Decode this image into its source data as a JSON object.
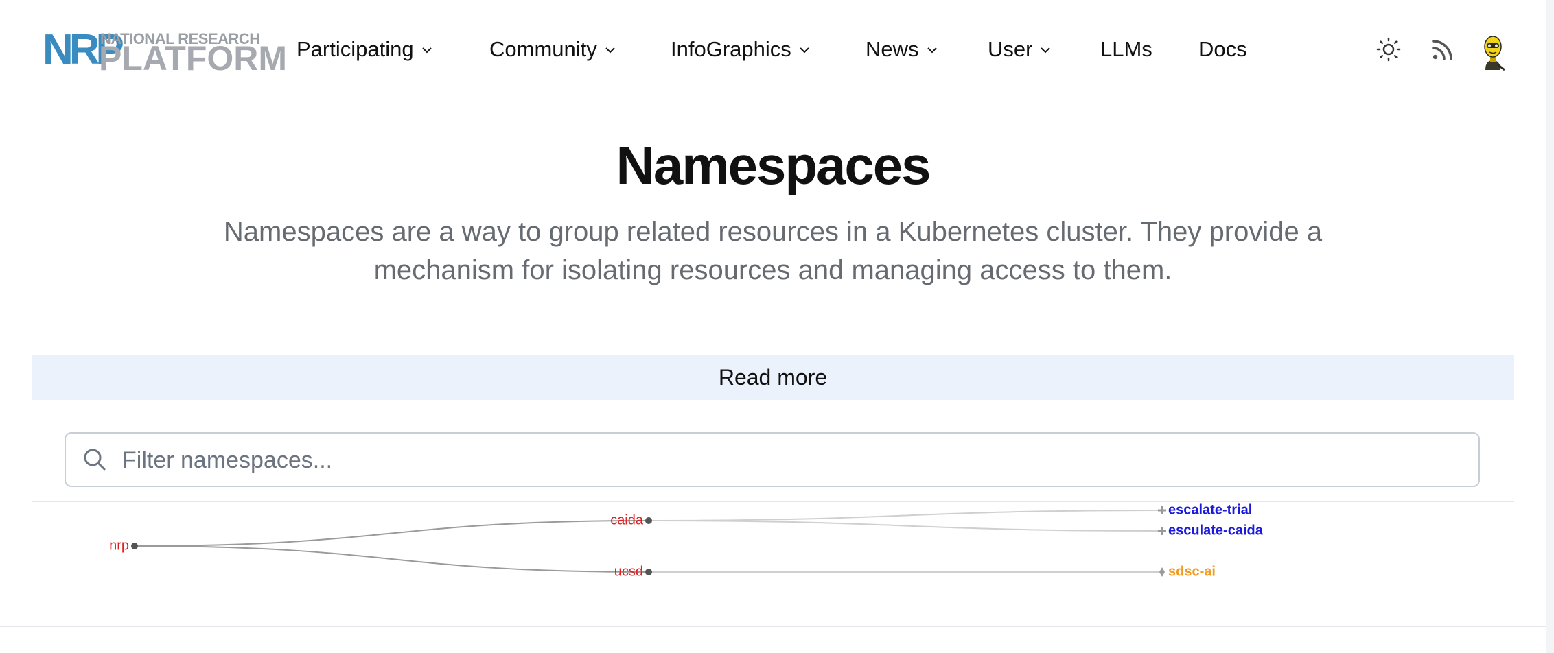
{
  "logo": {
    "mark": "NRP",
    "line1": "NATIONAL RESEARCH",
    "line2": "PLATFORM"
  },
  "nav": {
    "items": [
      {
        "label": "Participating",
        "dropdown": true
      },
      {
        "label": "Community",
        "dropdown": true
      },
      {
        "label": "InfoGraphics",
        "dropdown": true
      },
      {
        "label": "News",
        "dropdown": true
      },
      {
        "label": "User",
        "dropdown": true
      },
      {
        "label": "LLMs",
        "dropdown": false
      },
      {
        "label": "Docs",
        "dropdown": false
      }
    ],
    "icons": [
      "theme-toggle-icon",
      "rss-icon",
      "user-avatar-icon"
    ]
  },
  "hero": {
    "title": "Namespaces",
    "description": "Namespaces are a way to group related resources in a Kubernetes cluster. They provide a mechanism for isolating resources and managing access to them."
  },
  "read_more": {
    "label": "Read more"
  },
  "search": {
    "placeholder": "Filter namespaces...",
    "value": ""
  },
  "tree": {
    "root": {
      "label": "nrp",
      "color": "#e02020"
    },
    "groups": [
      {
        "label": "caida",
        "color": "#e02020",
        "children": [
          {
            "label": "escalate-trial",
            "color": "#1a1adb",
            "marker": "plus"
          },
          {
            "label": "esculate-caida",
            "color": "#1a1adb",
            "marker": "plus"
          }
        ]
      },
      {
        "label": "ucsd",
        "color": "#e02020",
        "children": [
          {
            "label": "sdsc-ai",
            "color": "#f39a1e",
            "marker": "diamond"
          }
        ]
      }
    ]
  },
  "colors": {
    "link_blue": "#1a1adb",
    "org_red": "#e02020",
    "orange": "#f39a1e",
    "readmore_bg": "#ecf2fb"
  }
}
